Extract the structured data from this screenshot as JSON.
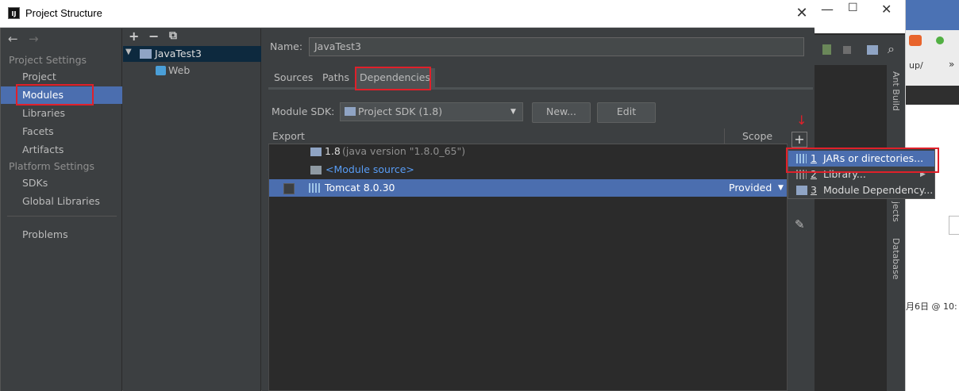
{
  "window": {
    "title": "Project Structure",
    "logo": "IJ",
    "close_glyph": "✕"
  },
  "nav": {
    "back_glyph": "←",
    "forward_glyph": "→",
    "project_settings_header": "Project Settings",
    "project_settings": [
      "Project",
      "Modules",
      "Libraries",
      "Facets",
      "Artifacts"
    ],
    "platform_settings_header": "Platform Settings",
    "platform_settings": [
      "SDKs",
      "Global Libraries"
    ],
    "problems": "Problems"
  },
  "tree": {
    "add": "+",
    "remove": "−",
    "copy": "⧉",
    "root": "JavaTest3",
    "child": "Web",
    "expand_glyph": "▼"
  },
  "detail": {
    "name_label": "Name:",
    "name_value": "JavaTest3",
    "tabs": [
      "Sources",
      "Paths",
      "Dependencies"
    ],
    "sdk_label": "Module SDK:",
    "sdk_value": "Project SDK (1.8)",
    "new_button": "New...",
    "edit_button": "Edit"
  },
  "dependencies": {
    "columns": [
      "Export",
      "Scope"
    ],
    "rows": [
      {
        "name": "1.8",
        "detail": "(java version \"1.8.0_65\")"
      },
      {
        "name": "<Module source>"
      },
      {
        "name": "Tomcat 8.0.30",
        "scope": "Provided"
      }
    ]
  },
  "add_menu": {
    "items": [
      {
        "mnemonic": "1",
        "label": "JARs or directories..."
      },
      {
        "mnemonic": "2",
        "label": "Library..."
      },
      {
        "mnemonic": "3",
        "label": "Module Dependency..."
      }
    ]
  },
  "background": {
    "side_panels": [
      "Ant Build",
      "Database"
    ],
    "fragments": [
      "up/",
      "jects",
      "月6日 @ 10:"
    ]
  },
  "colors": {
    "selection": "#4b6eaf",
    "annotation": "#e0202a",
    "panel": "#3c3f41"
  }
}
